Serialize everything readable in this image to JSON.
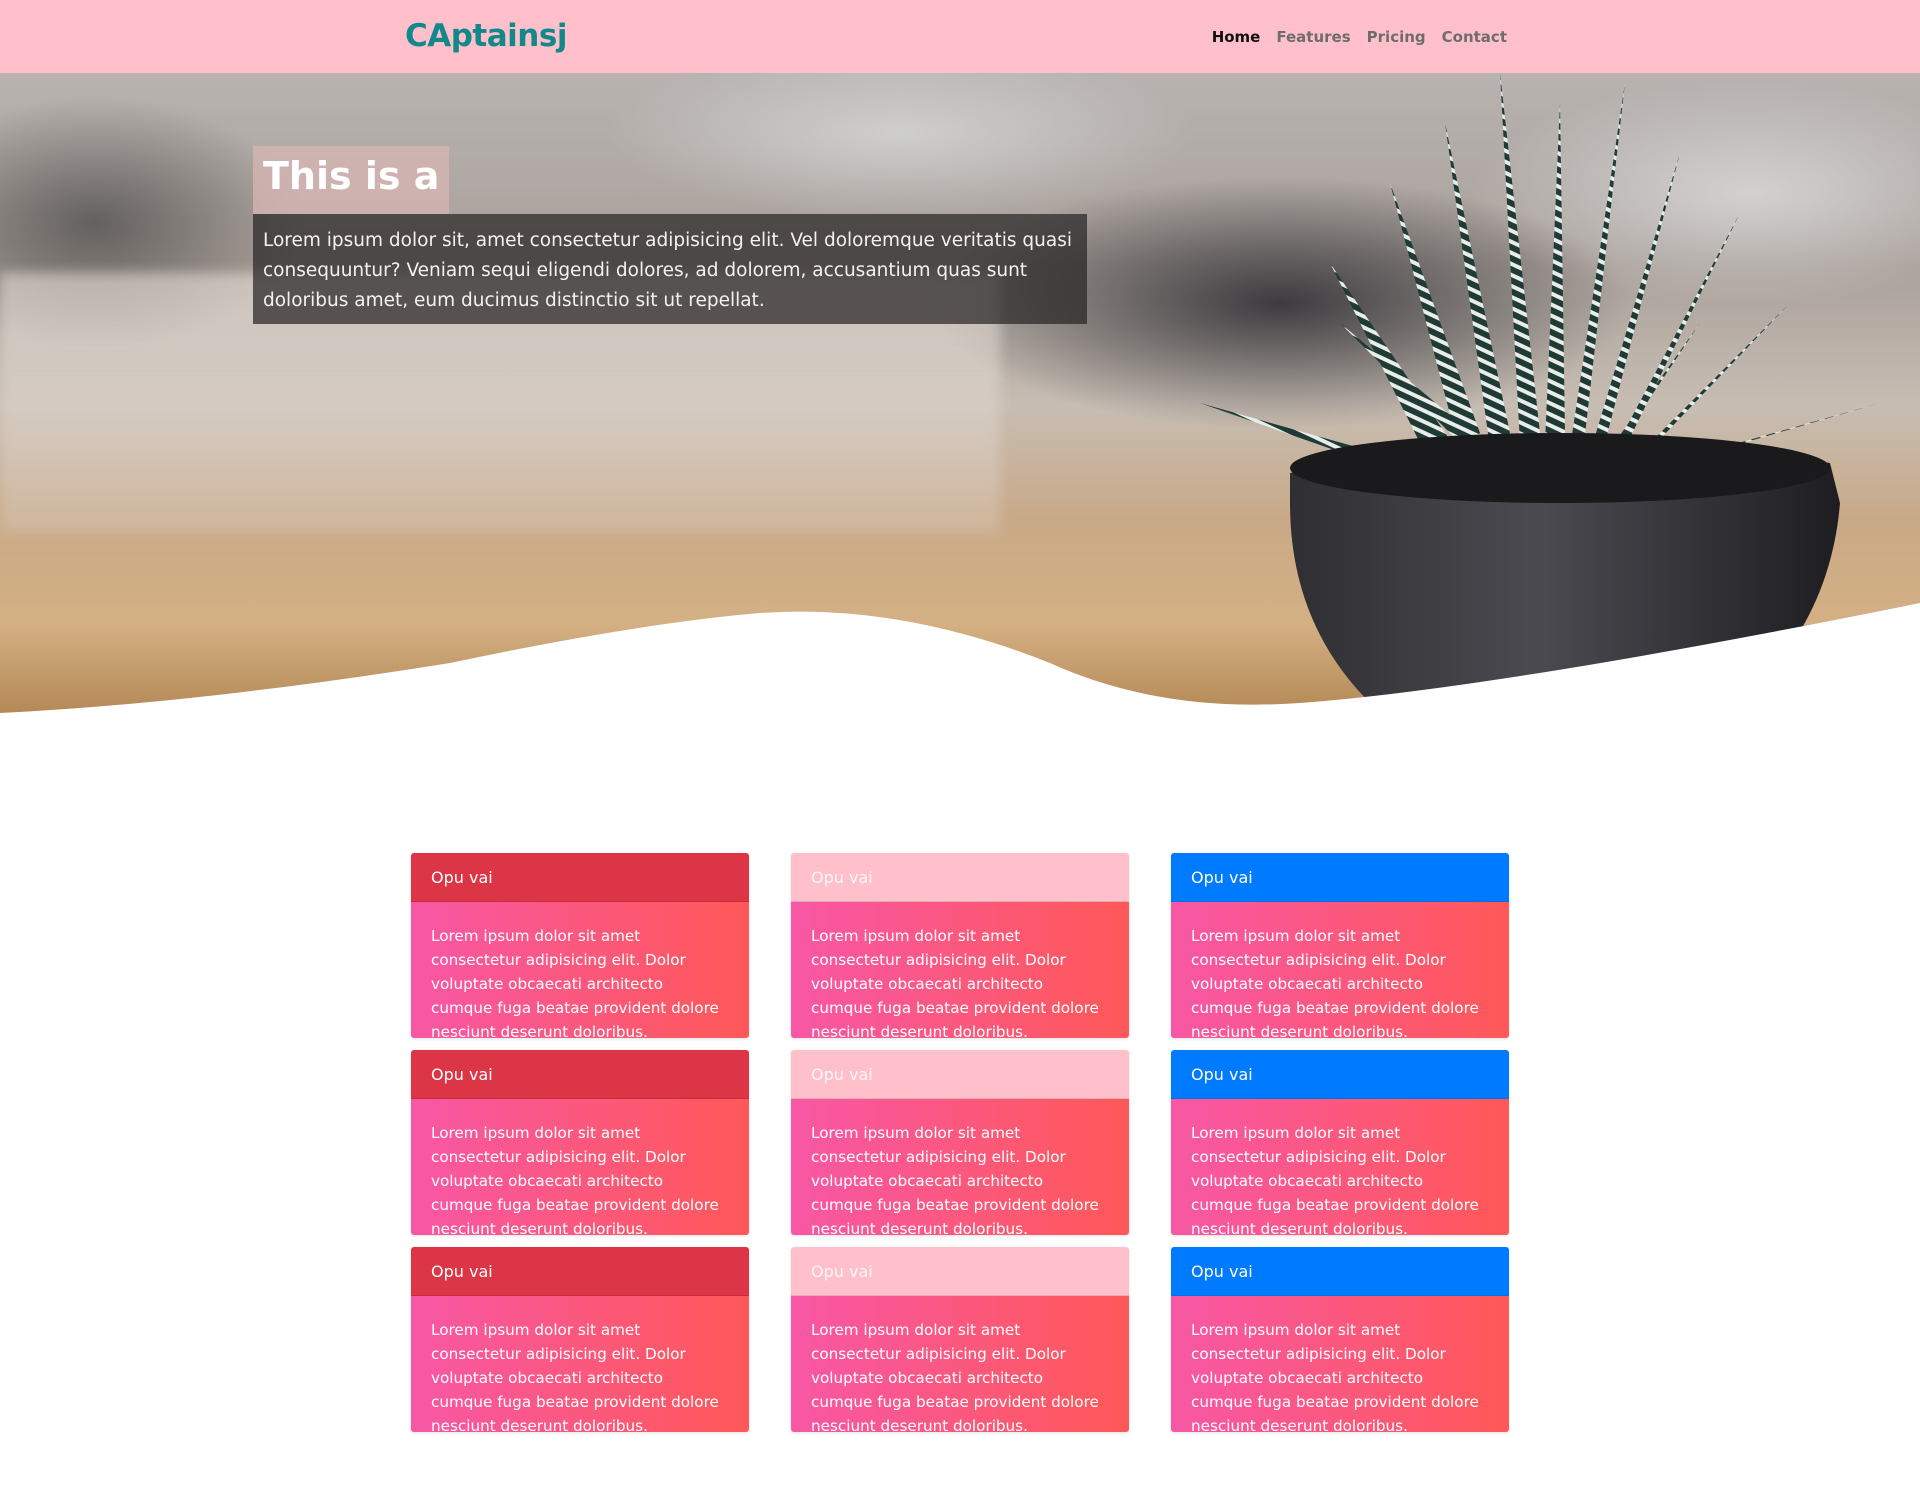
{
  "navbar": {
    "brand": "CAptainsj",
    "links": [
      {
        "label": "Home",
        "active": true
      },
      {
        "label": "Features",
        "active": false
      },
      {
        "label": "Pricing",
        "active": false
      },
      {
        "label": "Contact",
        "active": false
      }
    ]
  },
  "hero": {
    "title": "This is a",
    "text": "Lorem ipsum dolor sit, amet consectetur adipisicing elit. Vel doloremque veritatis quasi consequuntur? Veniam sequi eligendi dolores, ad dolorem, accusantium quas sunt doloribus amet, eum ducimus distinctio sit ut repellat."
  },
  "colors": {
    "navbar_bg": "#ffc0cb",
    "brand": "#11888a",
    "card_header_red": "#dc3545",
    "card_header_pink": "#ffc0cb",
    "card_header_blue": "#007bff",
    "card_body_gradient_start": "#f857a6",
    "card_body_gradient_end": "#ff5858"
  },
  "cards": [
    {
      "header": "Opu vai",
      "variant": "red",
      "body": "Lorem ipsum dolor sit amet consectetur adipisicing elit. Dolor voluptate obcaecati architecto cumque fuga beatae provident dolore nesciunt deserunt doloribus."
    },
    {
      "header": "Opu vai",
      "variant": "pink",
      "body": "Lorem ipsum dolor sit amet consectetur adipisicing elit. Dolor voluptate obcaecati architecto cumque fuga beatae provident dolore nesciunt deserunt doloribus."
    },
    {
      "header": "Opu vai",
      "variant": "blue",
      "body": "Lorem ipsum dolor sit amet consectetur adipisicing elit. Dolor voluptate obcaecati architecto cumque fuga beatae provident dolore nesciunt deserunt doloribus."
    },
    {
      "header": "Opu vai",
      "variant": "red",
      "body": "Lorem ipsum dolor sit amet consectetur adipisicing elit. Dolor voluptate obcaecati architecto cumque fuga beatae provident dolore nesciunt deserunt doloribus."
    },
    {
      "header": "Opu vai",
      "variant": "pink",
      "body": "Lorem ipsum dolor sit amet consectetur adipisicing elit. Dolor voluptate obcaecati architecto cumque fuga beatae provident dolore nesciunt deserunt doloribus."
    },
    {
      "header": "Opu vai",
      "variant": "blue",
      "body": "Lorem ipsum dolor sit amet consectetur adipisicing elit. Dolor voluptate obcaecati architecto cumque fuga beatae provident dolore nesciunt deserunt doloribus."
    },
    {
      "header": "Opu vai",
      "variant": "red",
      "body": "Lorem ipsum dolor sit amet consectetur adipisicing elit. Dolor voluptate obcaecati architecto cumque fuga beatae provident dolore nesciunt deserunt doloribus."
    },
    {
      "header": "Opu vai",
      "variant": "pink",
      "body": "Lorem ipsum dolor sit amet consectetur adipisicing elit. Dolor voluptate obcaecati architecto cumque fuga beatae provident dolore nesciunt deserunt doloribus."
    },
    {
      "header": "Opu vai",
      "variant": "blue",
      "body": "Lorem ipsum dolor sit amet consectetur adipisicing elit. Dolor voluptate obcaecati architecto cumque fuga beatae provident dolore nesciunt deserunt doloribus."
    }
  ]
}
